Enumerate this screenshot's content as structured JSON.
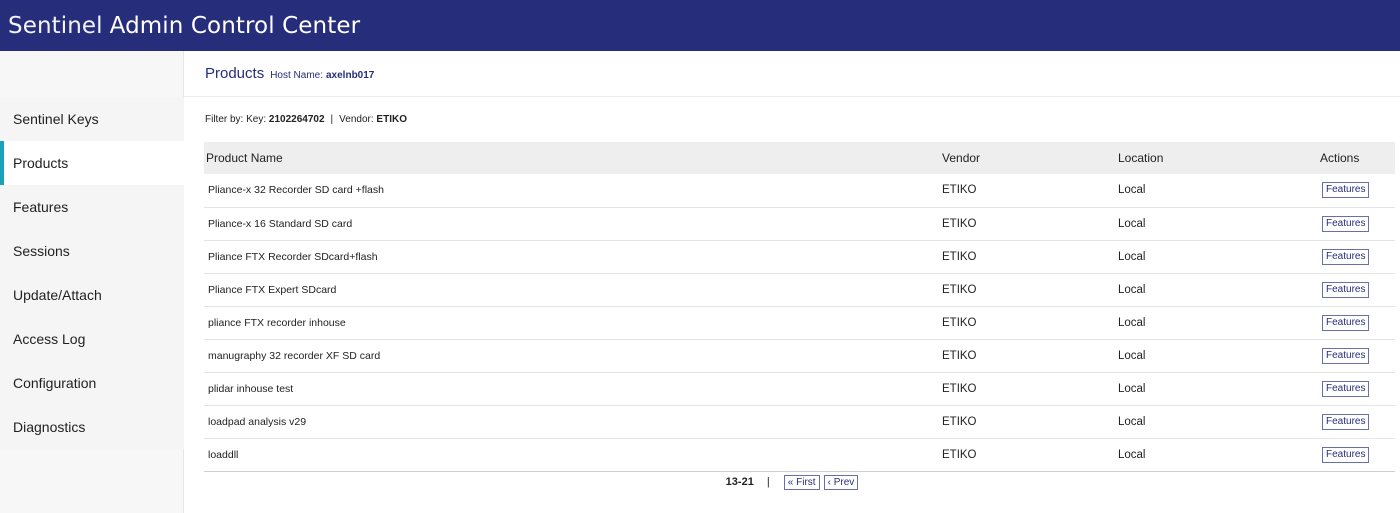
{
  "header": {
    "title_light": "Sentinel",
    "title_strong": "Admin Control Center"
  },
  "sidebar": {
    "items": [
      {
        "label": "Sentinel Keys",
        "active": false
      },
      {
        "label": "Products",
        "active": true
      },
      {
        "label": "Features",
        "active": false
      },
      {
        "label": "Sessions",
        "active": false
      },
      {
        "label": "Update/Attach",
        "active": false
      },
      {
        "label": "Access Log",
        "active": false
      },
      {
        "label": "Configuration",
        "active": false
      },
      {
        "label": "Diagnostics",
        "active": false
      }
    ]
  },
  "page": {
    "title": "Products",
    "host_label": "Host Name:",
    "host_value": "axelnb017"
  },
  "filter": {
    "prefix": "Filter by: Key:",
    "key_value": "2102264702",
    "separator": "|",
    "vendor_label": "Vendor:",
    "vendor_value": "ETIKO"
  },
  "table": {
    "headers": [
      "Product Name",
      "Vendor",
      "Location",
      "Actions"
    ],
    "action_label": "Features",
    "rows": [
      {
        "name": "Pliance-x 32 Recorder SD card +flash",
        "vendor": "ETIKO",
        "location": "Local"
      },
      {
        "name": "Pliance-x 16 Standard SD card",
        "vendor": "ETIKO",
        "location": "Local"
      },
      {
        "name": "Pliance FTX Recorder SDcard+flash",
        "vendor": "ETIKO",
        "location": "Local"
      },
      {
        "name": "Pliance FTX Expert SDcard",
        "vendor": "ETIKO",
        "location": "Local"
      },
      {
        "name": "pliance FTX recorder inhouse",
        "vendor": "ETIKO",
        "location": "Local"
      },
      {
        "name": "manugraphy 32 recorder XF SD card",
        "vendor": "ETIKO",
        "location": "Local"
      },
      {
        "name": "plidar inhouse test",
        "vendor": "ETIKO",
        "location": "Local"
      },
      {
        "name": "loadpad analysis v29",
        "vendor": "ETIKO",
        "location": "Local"
      },
      {
        "name": "loaddll",
        "vendor": "ETIKO",
        "location": "Local"
      }
    ]
  },
  "pager": {
    "range": "13-21",
    "separator": "|",
    "first_label": "« First",
    "prev_label": "‹ Prev"
  },
  "colors": {
    "header_bg": "#262d7a",
    "accent_active": "#1aa3b8"
  }
}
